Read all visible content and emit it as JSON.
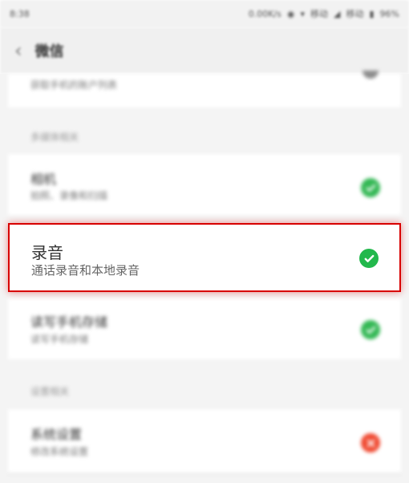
{
  "status_bar": {
    "time": "8:38",
    "network_speed": "0.00K/s",
    "signal_text": "移动",
    "signal_text_2": "移动",
    "battery": "96%"
  },
  "header": {
    "back_icon": "chevron-left-icon",
    "title": "微信"
  },
  "permissions": {
    "top_partial_subtitle": "获取手机的账户列表",
    "section_multimedia": "多媒体相关",
    "camera": {
      "title": "相机",
      "subtitle": "拍照、录像和扫描",
      "status_icon": "check-icon",
      "status_color": "#34b855"
    },
    "recording": {
      "title": "录音",
      "subtitle": "通话录音和本地录音",
      "status_icon": "check-icon",
      "status_color": "#22b84c"
    },
    "storage": {
      "title": "读写手机存储",
      "subtitle": "读写手机存储",
      "status_icon": "check-icon",
      "status_color": "#34b855"
    },
    "section_settings": "设置相关",
    "system_settings": {
      "title": "系统设置",
      "subtitle": "修改系统设置",
      "status_icon": "close-icon",
      "status_color": "#f04a32"
    }
  }
}
